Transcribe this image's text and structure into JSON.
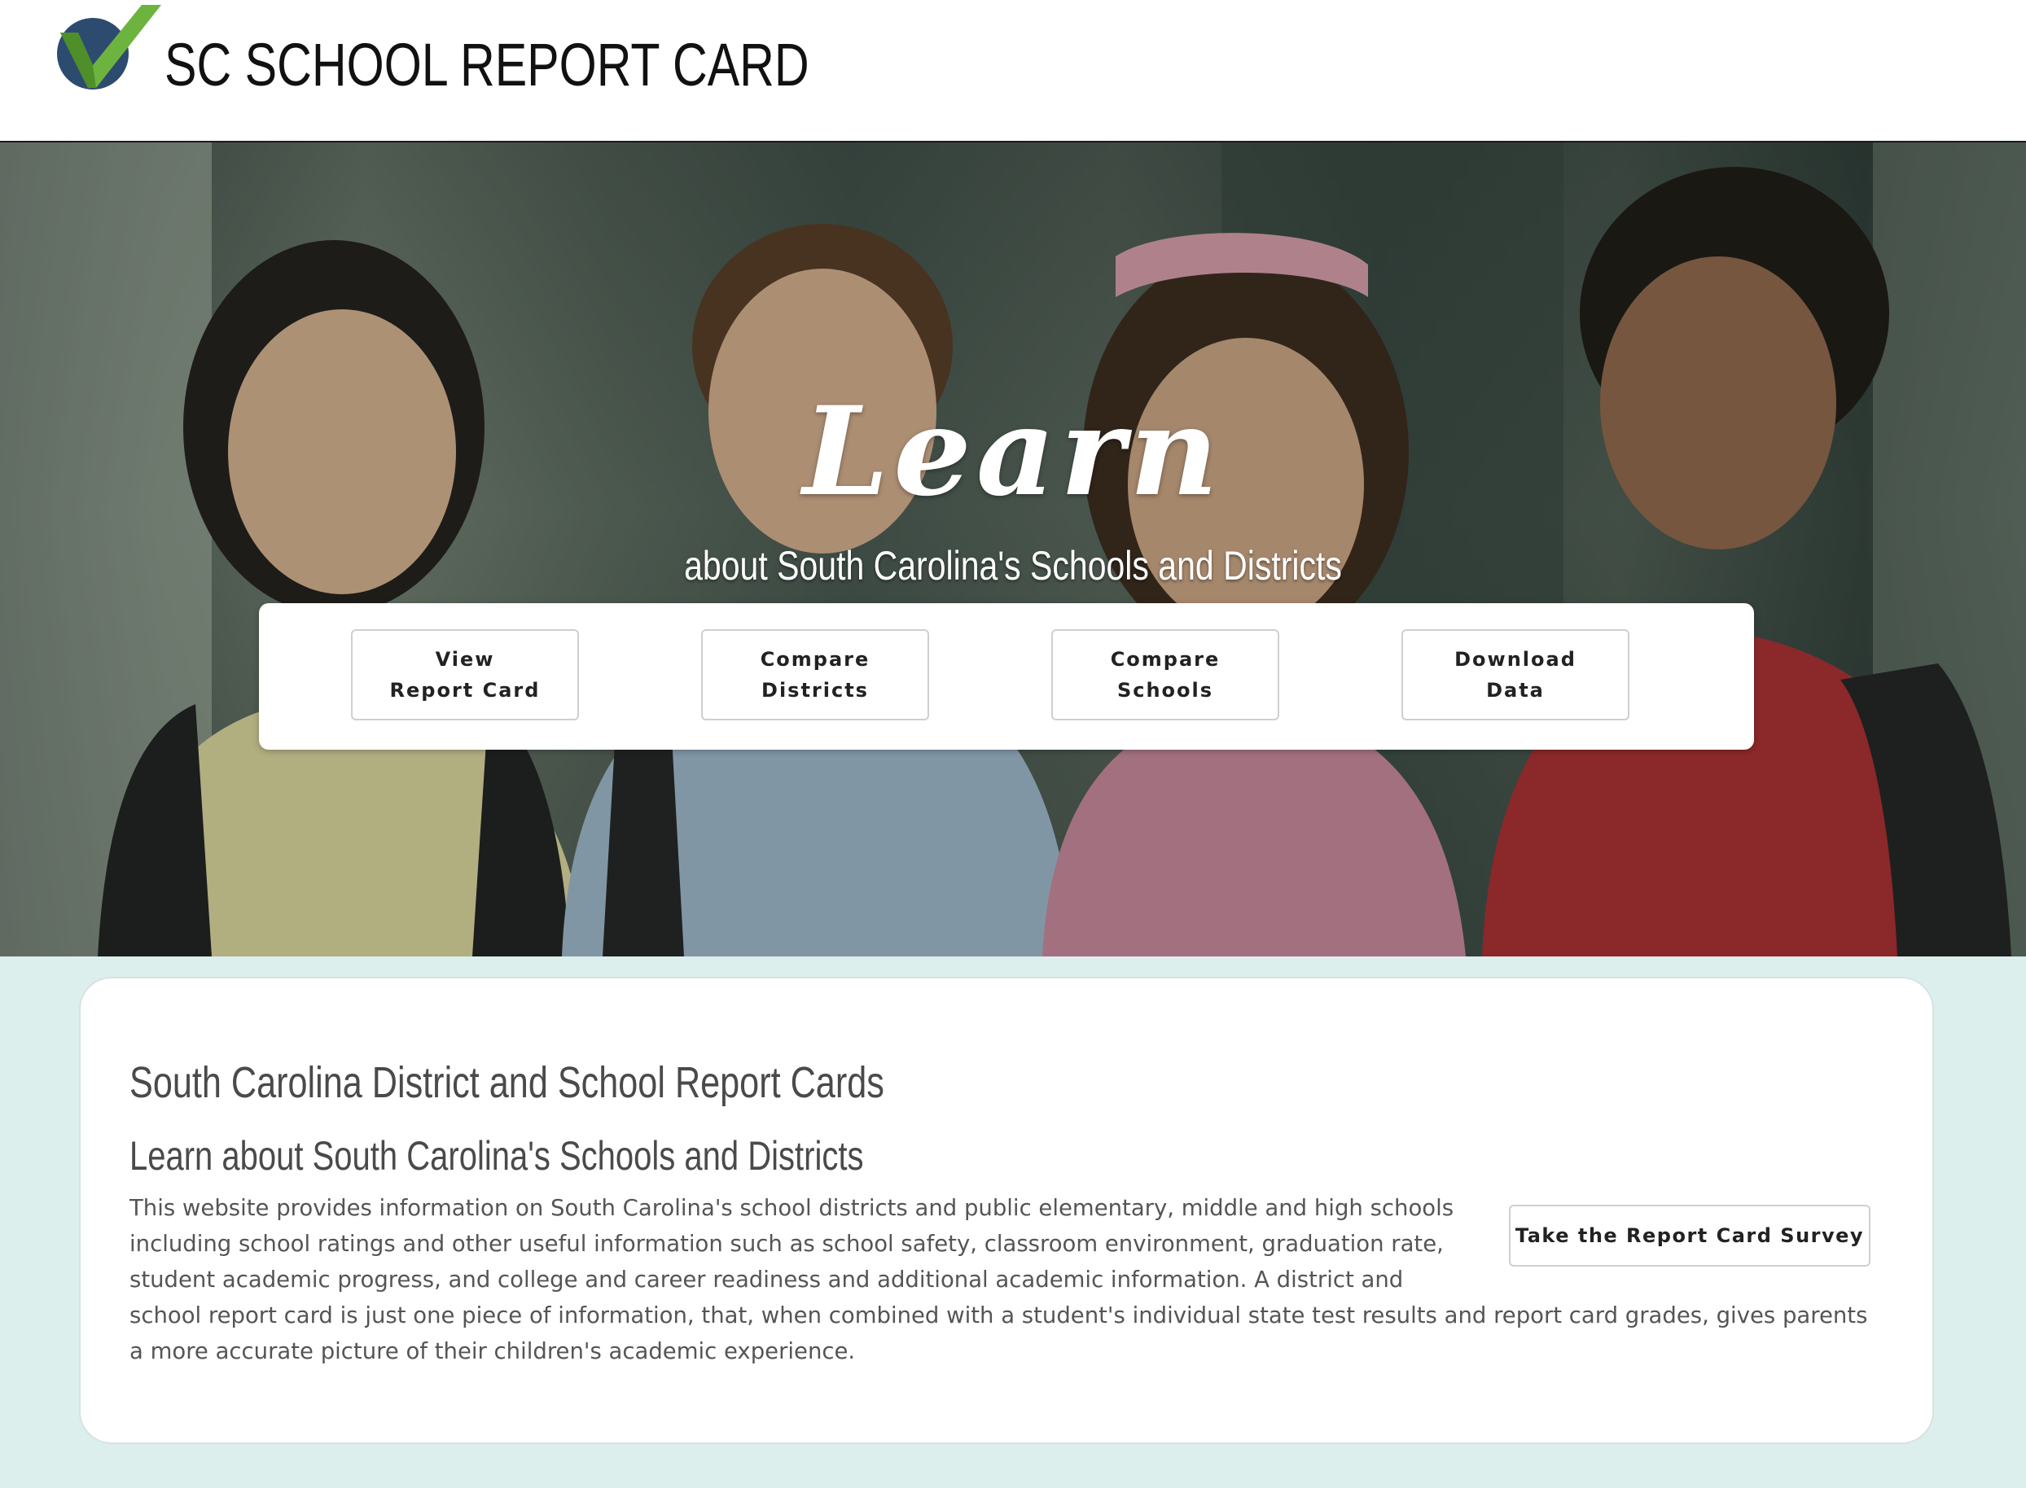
{
  "header": {
    "site_title": "SC SCHOOL REPORT CARD",
    "logo_icon": "checkmark-icon",
    "logo_colors": {
      "circle": "#2d4b6f",
      "check": "#6db33f"
    }
  },
  "hero": {
    "title": "Learn",
    "subtitle": "about South Carolina's Schools and Districts",
    "actions": [
      {
        "label": "View\nReport Card"
      },
      {
        "label": "Compare\nDistricts"
      },
      {
        "label": "Compare\nSchools"
      },
      {
        "label": "Download\nData"
      }
    ]
  },
  "info": {
    "heading": "South Carolina District and School Report Cards",
    "subheading": "Learn about South Carolina's Schools and Districts",
    "body": "This website provides information on South Carolina's school districts and public elementary, middle and high schools including school ratings and other useful information such as school safety, classroom environment, graduation rate, student academic progress, and college and career readiness and additional academic information. A district and school report card is just one piece of information, that, when combined with a student's individual state test results and report card grades, gives parents a more accurate picture of their children's academic experience.",
    "survey_button": "Take the Report Card Survey"
  },
  "colors": {
    "page_background": "#dcefec",
    "card_background": "#ffffff",
    "heading_text": "#4a4a4a",
    "body_text": "#555555"
  }
}
